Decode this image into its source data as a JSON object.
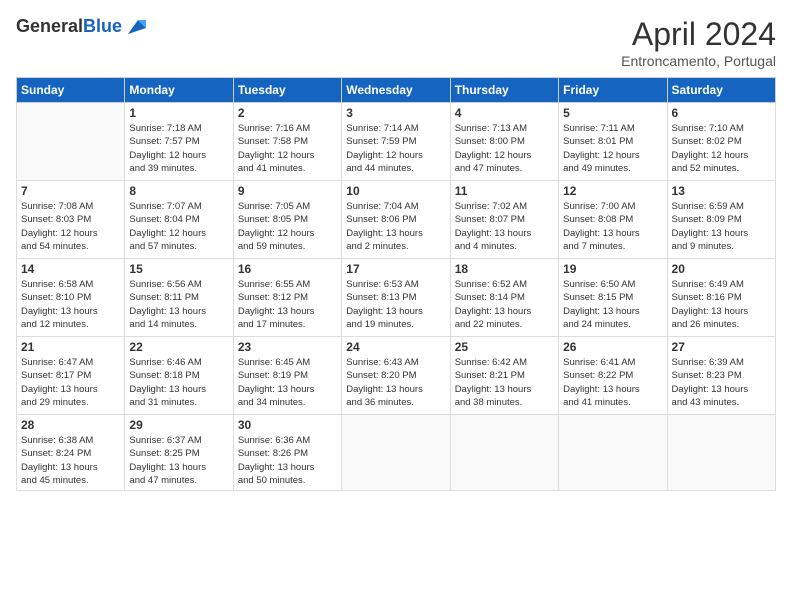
{
  "logo": {
    "general": "General",
    "blue": "Blue"
  },
  "title": "April 2024",
  "subtitle": "Entroncamento, Portugal",
  "headers": [
    "Sunday",
    "Monday",
    "Tuesday",
    "Wednesday",
    "Thursday",
    "Friday",
    "Saturday"
  ],
  "weeks": [
    [
      {
        "day": "",
        "info": ""
      },
      {
        "day": "1",
        "info": "Sunrise: 7:18 AM\nSunset: 7:57 PM\nDaylight: 12 hours\nand 39 minutes."
      },
      {
        "day": "2",
        "info": "Sunrise: 7:16 AM\nSunset: 7:58 PM\nDaylight: 12 hours\nand 41 minutes."
      },
      {
        "day": "3",
        "info": "Sunrise: 7:14 AM\nSunset: 7:59 PM\nDaylight: 12 hours\nand 44 minutes."
      },
      {
        "day": "4",
        "info": "Sunrise: 7:13 AM\nSunset: 8:00 PM\nDaylight: 12 hours\nand 47 minutes."
      },
      {
        "day": "5",
        "info": "Sunrise: 7:11 AM\nSunset: 8:01 PM\nDaylight: 12 hours\nand 49 minutes."
      },
      {
        "day": "6",
        "info": "Sunrise: 7:10 AM\nSunset: 8:02 PM\nDaylight: 12 hours\nand 52 minutes."
      }
    ],
    [
      {
        "day": "7",
        "info": "Sunrise: 7:08 AM\nSunset: 8:03 PM\nDaylight: 12 hours\nand 54 minutes."
      },
      {
        "day": "8",
        "info": "Sunrise: 7:07 AM\nSunset: 8:04 PM\nDaylight: 12 hours\nand 57 minutes."
      },
      {
        "day": "9",
        "info": "Sunrise: 7:05 AM\nSunset: 8:05 PM\nDaylight: 12 hours\nand 59 minutes."
      },
      {
        "day": "10",
        "info": "Sunrise: 7:04 AM\nSunset: 8:06 PM\nDaylight: 13 hours\nand 2 minutes."
      },
      {
        "day": "11",
        "info": "Sunrise: 7:02 AM\nSunset: 8:07 PM\nDaylight: 13 hours\nand 4 minutes."
      },
      {
        "day": "12",
        "info": "Sunrise: 7:00 AM\nSunset: 8:08 PM\nDaylight: 13 hours\nand 7 minutes."
      },
      {
        "day": "13",
        "info": "Sunrise: 6:59 AM\nSunset: 8:09 PM\nDaylight: 13 hours\nand 9 minutes."
      }
    ],
    [
      {
        "day": "14",
        "info": "Sunrise: 6:58 AM\nSunset: 8:10 PM\nDaylight: 13 hours\nand 12 minutes."
      },
      {
        "day": "15",
        "info": "Sunrise: 6:56 AM\nSunset: 8:11 PM\nDaylight: 13 hours\nand 14 minutes."
      },
      {
        "day": "16",
        "info": "Sunrise: 6:55 AM\nSunset: 8:12 PM\nDaylight: 13 hours\nand 17 minutes."
      },
      {
        "day": "17",
        "info": "Sunrise: 6:53 AM\nSunset: 8:13 PM\nDaylight: 13 hours\nand 19 minutes."
      },
      {
        "day": "18",
        "info": "Sunrise: 6:52 AM\nSunset: 8:14 PM\nDaylight: 13 hours\nand 22 minutes."
      },
      {
        "day": "19",
        "info": "Sunrise: 6:50 AM\nSunset: 8:15 PM\nDaylight: 13 hours\nand 24 minutes."
      },
      {
        "day": "20",
        "info": "Sunrise: 6:49 AM\nSunset: 8:16 PM\nDaylight: 13 hours\nand 26 minutes."
      }
    ],
    [
      {
        "day": "21",
        "info": "Sunrise: 6:47 AM\nSunset: 8:17 PM\nDaylight: 13 hours\nand 29 minutes."
      },
      {
        "day": "22",
        "info": "Sunrise: 6:46 AM\nSunset: 8:18 PM\nDaylight: 13 hours\nand 31 minutes."
      },
      {
        "day": "23",
        "info": "Sunrise: 6:45 AM\nSunset: 8:19 PM\nDaylight: 13 hours\nand 34 minutes."
      },
      {
        "day": "24",
        "info": "Sunrise: 6:43 AM\nSunset: 8:20 PM\nDaylight: 13 hours\nand 36 minutes."
      },
      {
        "day": "25",
        "info": "Sunrise: 6:42 AM\nSunset: 8:21 PM\nDaylight: 13 hours\nand 38 minutes."
      },
      {
        "day": "26",
        "info": "Sunrise: 6:41 AM\nSunset: 8:22 PM\nDaylight: 13 hours\nand 41 minutes."
      },
      {
        "day": "27",
        "info": "Sunrise: 6:39 AM\nSunset: 8:23 PM\nDaylight: 13 hours\nand 43 minutes."
      }
    ],
    [
      {
        "day": "28",
        "info": "Sunrise: 6:38 AM\nSunset: 8:24 PM\nDaylight: 13 hours\nand 45 minutes."
      },
      {
        "day": "29",
        "info": "Sunrise: 6:37 AM\nSunset: 8:25 PM\nDaylight: 13 hours\nand 47 minutes."
      },
      {
        "day": "30",
        "info": "Sunrise: 6:36 AM\nSunset: 8:26 PM\nDaylight: 13 hours\nand 50 minutes."
      },
      {
        "day": "",
        "info": ""
      },
      {
        "day": "",
        "info": ""
      },
      {
        "day": "",
        "info": ""
      },
      {
        "day": "",
        "info": ""
      }
    ]
  ]
}
